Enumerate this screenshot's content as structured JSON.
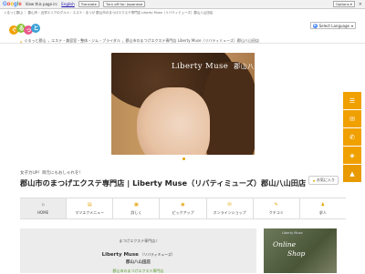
{
  "google_bar": {
    "logo": "Google",
    "view_text": "View this page in:",
    "language": "English",
    "translate_button": "Translate",
    "turn_off_button": "Turn off for: Japanese",
    "options_button": "Options ▾",
    "close": "✕"
  },
  "breadcrumb_top": "ぐるっと郡山 ｜ 郡山市・近郊エリアのグルメ・エステ・まつげ  郡山市のまつげエクステ専門店 Liberty Muse（リバティミューズ）郡山八山田店",
  "logo_text": "ぐるっと郡山",
  "select_language": "Select Language",
  "breadcrumb": [
    "ぐるっと郡山",
    "エステ・美容室・整体・ジム・ブライダル",
    "郡山市のまつげエクステ専門店 Liberty Muse（リバティミューズ）郡山八山田店"
  ],
  "hero": {
    "title_en": "Liberty Muse",
    "title_jp": "郡山八山田"
  },
  "subtitle": "女子力UP！目元にもおしゃれを！",
  "page_title_line1": "郡山市のまつげエクステ専門店 | Liberty Muse（リバティミューズ）郡山八山田店",
  "favorite_button": "お気に入り",
  "menu": [
    {
      "label": "HOME",
      "icon": "home-icon",
      "glyph": "⌂"
    },
    {
      "label": "マツエクメニュー",
      "icon": "list-icon",
      "glyph": "▤"
    },
    {
      "label": "詳しく",
      "icon": "info-icon",
      "glyph": "▣"
    },
    {
      "label": "ピックアップ",
      "icon": "pickup-icon",
      "glyph": "◉"
    },
    {
      "label": "オンラインショップ",
      "icon": "shop-icon",
      "glyph": "✉"
    },
    {
      "label": "クチコミ",
      "icon": "comment-icon",
      "glyph": "✎"
    },
    {
      "label": "求人",
      "icon": "recruit-icon",
      "glyph": "♟"
    }
  ],
  "intro_box": {
    "intro": "まつげエクステ専門店♪",
    "name": "Liberty Muse",
    "name_kana": "（リバティミューズ）",
    "store": "郡山八山田店",
    "link": "郡山市のまつげエクステ専門店"
  },
  "online_shop": {
    "small": "Liberty Muse",
    "line1": "Online",
    "line2": "Shop"
  },
  "side_buttons": [
    {
      "glyph": "☰",
      "icon": "menu-icon"
    },
    {
      "glyph": "✉",
      "icon": "mail-icon"
    },
    {
      "glyph": "✆",
      "icon": "phone-icon"
    },
    {
      "glyph": "◈",
      "icon": "map-icon"
    },
    {
      "glyph": "▲",
      "icon": "top-arrow-icon"
    }
  ],
  "colors": {
    "accent": "#f0a000",
    "green": "#5a9a2c"
  }
}
